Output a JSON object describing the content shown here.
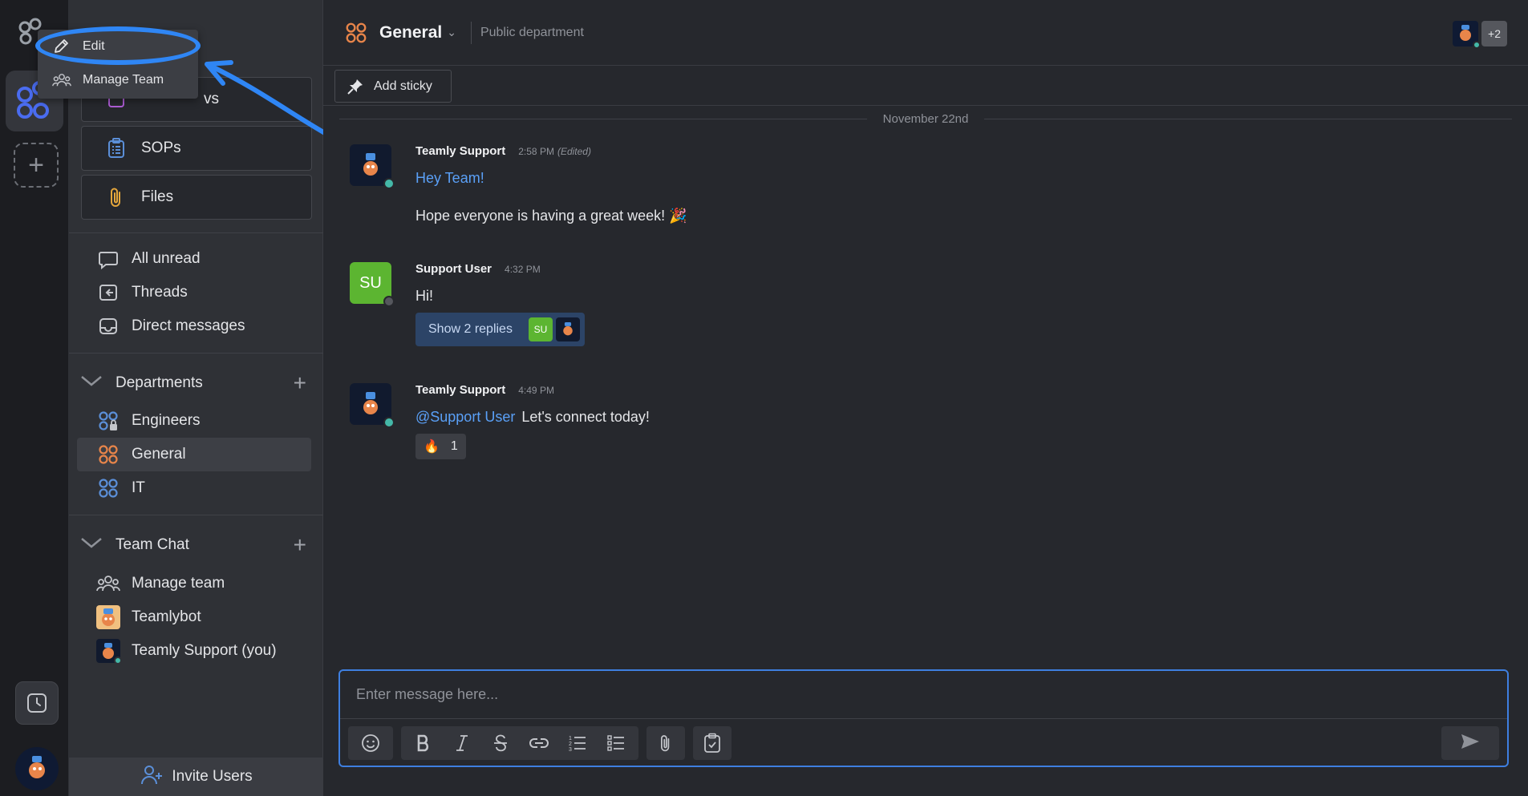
{
  "menu": {
    "edit_label": "Edit",
    "manage_team_label": "Manage Team"
  },
  "sidebar": {
    "partial_item_label": "vs",
    "buttons": [
      {
        "label": "SOPs",
        "icon": "checklist-icon"
      },
      {
        "label": "Files",
        "icon": "paperclip-icon"
      }
    ],
    "nav": [
      {
        "label": "All unread",
        "icon": "chat-bubble-icon"
      },
      {
        "label": "Threads",
        "icon": "threads-icon"
      },
      {
        "label": "Direct messages",
        "icon": "inbox-icon"
      }
    ],
    "departments": {
      "title": "Departments",
      "items": [
        {
          "label": "Engineers",
          "icon": "private-department-icon"
        },
        {
          "label": "General",
          "icon": "department-icon",
          "active": true
        },
        {
          "label": "IT",
          "icon": "department-icon"
        }
      ]
    },
    "team_chat": {
      "title": "Team Chat",
      "items": [
        {
          "label": "Manage team",
          "icon": "team-icon"
        },
        {
          "label": "Teamlybot",
          "icon": "bot-avatar"
        },
        {
          "label": "Teamly Support (you)",
          "icon": "user-avatar"
        }
      ]
    },
    "invite_label": "Invite Users"
  },
  "header": {
    "channel": "General",
    "subtitle": "Public department",
    "extra_members": "+2"
  },
  "sticky": {
    "add_label": "Add sticky"
  },
  "date_separator": "November 22nd",
  "messages": [
    {
      "author": "Teamly Support",
      "time": "2:58 PM",
      "edited": "(Edited)",
      "line1": "Hey Team!",
      "line2": "Hope everyone is having a great week! 🎉"
    },
    {
      "author": "Support User",
      "initials": "SU",
      "time": "4:32 PM",
      "line1": "Hi!",
      "replies_label": "Show 2 replies",
      "reply_avatar_initials": "SU"
    },
    {
      "author": "Teamly Support",
      "time": "4:49 PM",
      "mention": "@Support User",
      "text": "Let's connect today!",
      "reaction_emoji": "🔥",
      "reaction_count": "1"
    }
  ],
  "composer": {
    "placeholder": "Enter message here..."
  },
  "colors": {
    "accent": "#2f86f5",
    "department_orange": "#e8854a",
    "department_blue": "#5b8fd8",
    "online": "#44b8a8",
    "su_green": "#5cb531"
  }
}
